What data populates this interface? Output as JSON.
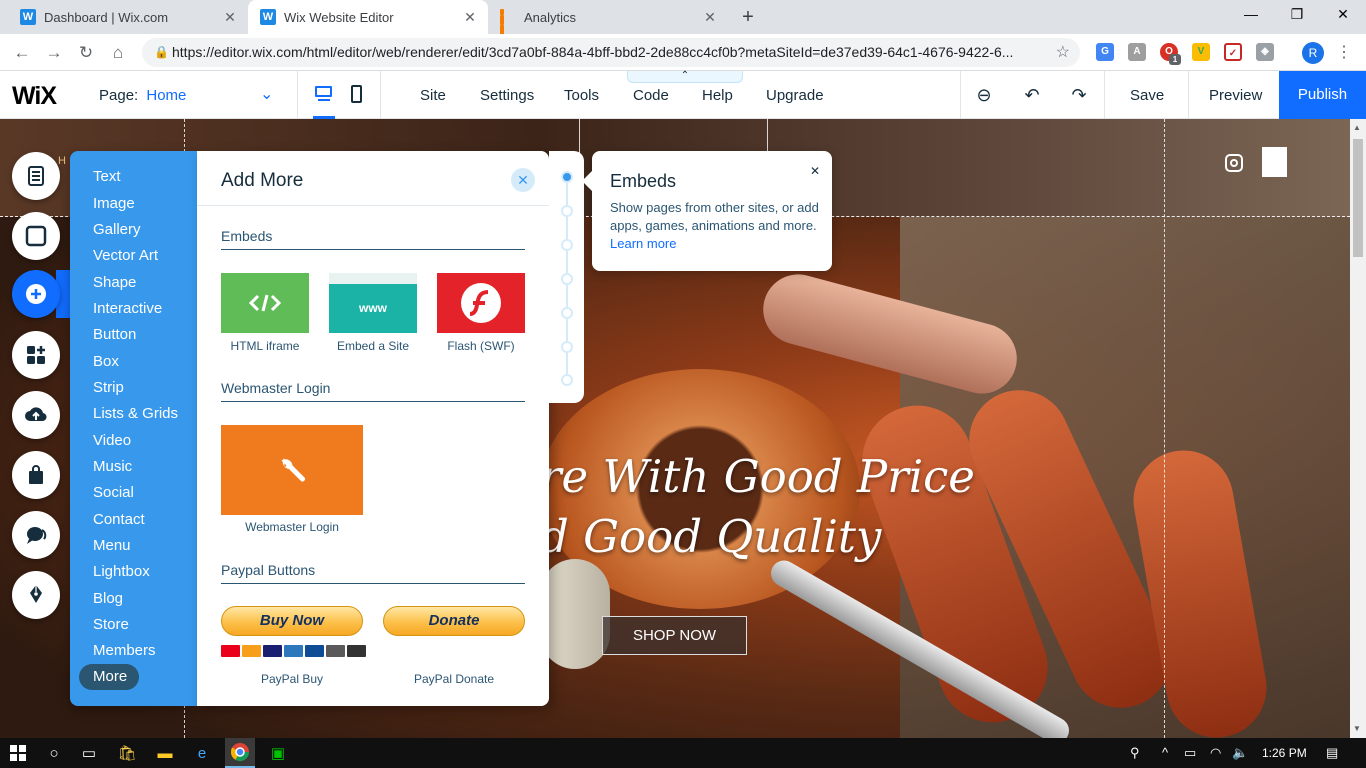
{
  "browser": {
    "tabs": [
      {
        "title": "Dashboard | Wix.com",
        "icon": "wix-favicon"
      },
      {
        "title": "Wix Website Editor",
        "icon": "wix-favicon"
      },
      {
        "title": "Analytics",
        "icon": "analytics-favicon"
      }
    ],
    "new_tab_label": "+",
    "url": "https://editor.wix.com/html/editor/web/renderer/edit/3cd7a0bf-884a-4bff-bbd2-2de88cc4cf0b?metaSiteId=de37ed39-64c1-4676-9422-6...",
    "profile_initial": "R",
    "extension_badge": "1"
  },
  "wix_topbar": {
    "logo": "WiX",
    "page_label": "Page:",
    "page_value": "Home",
    "menu": [
      "Site",
      "Settings",
      "Tools",
      "Code",
      "Help",
      "Upgrade"
    ],
    "save": "Save",
    "preview": "Preview",
    "publish": "Publish",
    "publish_color": "#116dff"
  },
  "add_panel": {
    "categories": [
      "Text",
      "Image",
      "Gallery",
      "Vector Art",
      "Shape",
      "Interactive",
      "Button",
      "Box",
      "Strip",
      "Lists & Grids",
      "Video",
      "Music",
      "Social",
      "Contact",
      "Menu",
      "Lightbox",
      "Blog",
      "Store",
      "Members"
    ],
    "more": "More",
    "title": "Add More",
    "sections": {
      "embeds": {
        "heading": "Embeds",
        "items": [
          {
            "label": "HTML iframe",
            "icon": "code-icon",
            "color": "#60bc57"
          },
          {
            "label": "Embed a Site",
            "icon": "www-icon",
            "color": "#1ab3a6"
          },
          {
            "label": "Flash (SWF)",
            "icon": "flash-icon",
            "color": "#e32229"
          }
        ]
      },
      "webmaster": {
        "heading": "Webmaster Login",
        "items": [
          {
            "label": "Webmaster Login",
            "icon": "wrench-icon",
            "color": "#f07b1f"
          }
        ]
      },
      "paypal": {
        "heading": "Paypal Buttons",
        "buy_text": "Buy Now",
        "donate_text": "Donate",
        "buy_label": "PayPal Buy",
        "donate_label": "PayPal Donate"
      }
    },
    "embed_www_text": "www"
  },
  "tooltip": {
    "title": "Embeds",
    "text": "Show pages from other sites, or add apps, games, animations and more.",
    "link": "Learn more"
  },
  "canvas": {
    "headline_line1": "re With Good Price",
    "headline_line2": "d Good Quality",
    "shop_button": "SHOP NOW",
    "corner_letter": "H"
  },
  "taskbar": {
    "time": "1:26 PM"
  }
}
